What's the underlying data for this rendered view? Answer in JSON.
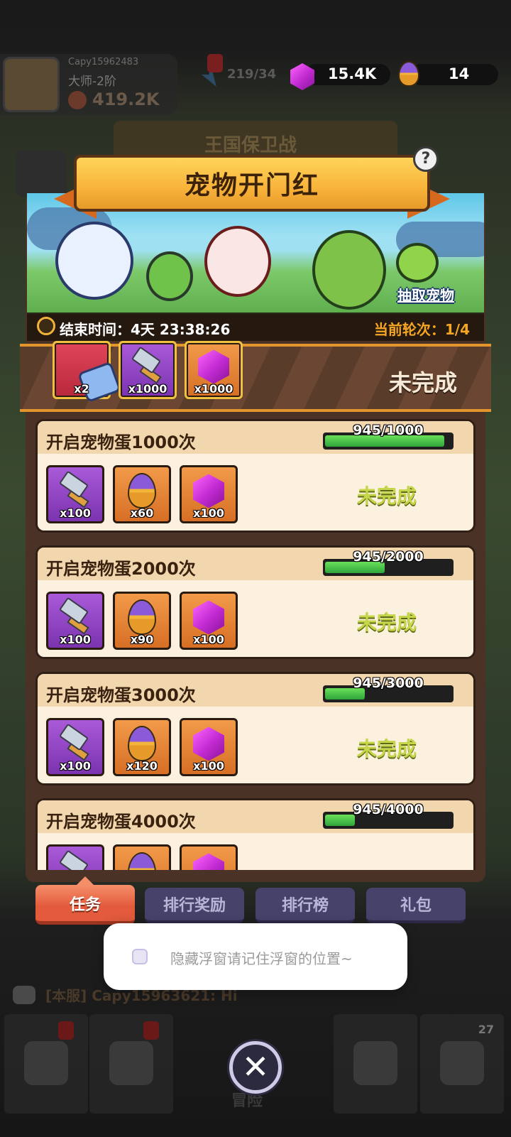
{
  "background": {
    "player_name": "Capy15962483",
    "player_rank": "大师-2阶",
    "player_power": "419.2K",
    "energy": "219/34",
    "mode_title": "王国保卫战",
    "chat_message": "[本服] Capy15963621: Hi",
    "nav_badge_count": "27",
    "adventure_label": "冒险"
  },
  "currency": {
    "gems": "15.4K",
    "eggs": "14"
  },
  "event": {
    "title": "宠物开门红",
    "help_label": "?",
    "draw_pet_link": "抽取宠物",
    "end_time_label": "结束时间：4天 23:38:26",
    "round_label": "当前轮次：1/4"
  },
  "stage_reward": {
    "status": "未完成",
    "items": [
      {
        "icon": "ticket-icon",
        "count": "x2",
        "color": "red"
      },
      {
        "icon": "hammer-icon",
        "count": "x1000",
        "color": "purple"
      },
      {
        "icon": "gem-icon",
        "count": "x1000",
        "color": "orange"
      }
    ]
  },
  "tasks": [
    {
      "title": "开启宠物蛋1000次",
      "progress_text": "945/1000",
      "progress_value": 945,
      "progress_max": 1000,
      "status": "未完成",
      "rewards": [
        {
          "icon": "hammer-icon",
          "count": "x100"
        },
        {
          "icon": "egg-icon",
          "count": "x60"
        },
        {
          "icon": "gem-icon",
          "count": "x100"
        }
      ]
    },
    {
      "title": "开启宠物蛋2000次",
      "progress_text": "945/2000",
      "progress_value": 945,
      "progress_max": 2000,
      "status": "未完成",
      "rewards": [
        {
          "icon": "hammer-icon",
          "count": "x100"
        },
        {
          "icon": "egg-icon",
          "count": "x90"
        },
        {
          "icon": "gem-icon",
          "count": "x100"
        }
      ]
    },
    {
      "title": "开启宠物蛋3000次",
      "progress_text": "945/3000",
      "progress_value": 945,
      "progress_max": 3000,
      "status": "未完成",
      "rewards": [
        {
          "icon": "hammer-icon",
          "count": "x100"
        },
        {
          "icon": "egg-icon",
          "count": "x120"
        },
        {
          "icon": "gem-icon",
          "count": "x100"
        }
      ]
    },
    {
      "title": "开启宠物蛋4000次",
      "progress_text": "945/4000",
      "progress_value": 945,
      "progress_max": 4000,
      "status": "",
      "rewards": [
        {
          "icon": "hammer-icon",
          "count": ""
        },
        {
          "icon": "egg-icon",
          "count": ""
        },
        {
          "icon": "gem-icon",
          "count": ""
        }
      ]
    }
  ],
  "tabs": [
    "任务",
    "排行奖励",
    "排行榜",
    "礼包"
  ],
  "active_tab": 0,
  "toast": {
    "text": "隐藏浮窗请记住浮窗的位置~"
  },
  "close_label": "✕",
  "colors": {
    "progress_green": "#2fa53b",
    "status_yellow": "#c6d64a",
    "active_tab": "#e35a3c",
    "title_gold": "#f8b33a"
  }
}
